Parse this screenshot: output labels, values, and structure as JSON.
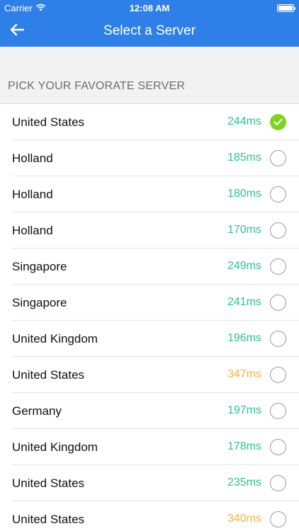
{
  "status_bar": {
    "carrier": "Carrier",
    "time": "12:08 AM"
  },
  "nav": {
    "title": "Select a Server"
  },
  "section": {
    "title": "PICK YOUR FAVORATE SERVER"
  },
  "colors": {
    "accent": "#2f7fe8",
    "ping_good": "#2ec28d",
    "ping_slow": "#f0b04a",
    "selected": "#7ed321"
  },
  "servers": [
    {
      "name": "United States",
      "ping": "244ms",
      "status": "good",
      "selected": true
    },
    {
      "name": "Holland",
      "ping": "185ms",
      "status": "good",
      "selected": false
    },
    {
      "name": "Holland",
      "ping": "180ms",
      "status": "good",
      "selected": false
    },
    {
      "name": "Holland",
      "ping": "170ms",
      "status": "good",
      "selected": false
    },
    {
      "name": "Singapore",
      "ping": "249ms",
      "status": "good",
      "selected": false
    },
    {
      "name": "Singapore",
      "ping": "241ms",
      "status": "good",
      "selected": false
    },
    {
      "name": "United Kingdom",
      "ping": "196ms",
      "status": "good",
      "selected": false
    },
    {
      "name": "United States",
      "ping": "347ms",
      "status": "slow",
      "selected": false
    },
    {
      "name": "Germany",
      "ping": "197ms",
      "status": "good",
      "selected": false
    },
    {
      "name": "United Kingdom",
      "ping": "178ms",
      "status": "good",
      "selected": false
    },
    {
      "name": "United States",
      "ping": "235ms",
      "status": "good",
      "selected": false
    },
    {
      "name": "United States",
      "ping": "340ms",
      "status": "slow",
      "selected": false
    }
  ]
}
